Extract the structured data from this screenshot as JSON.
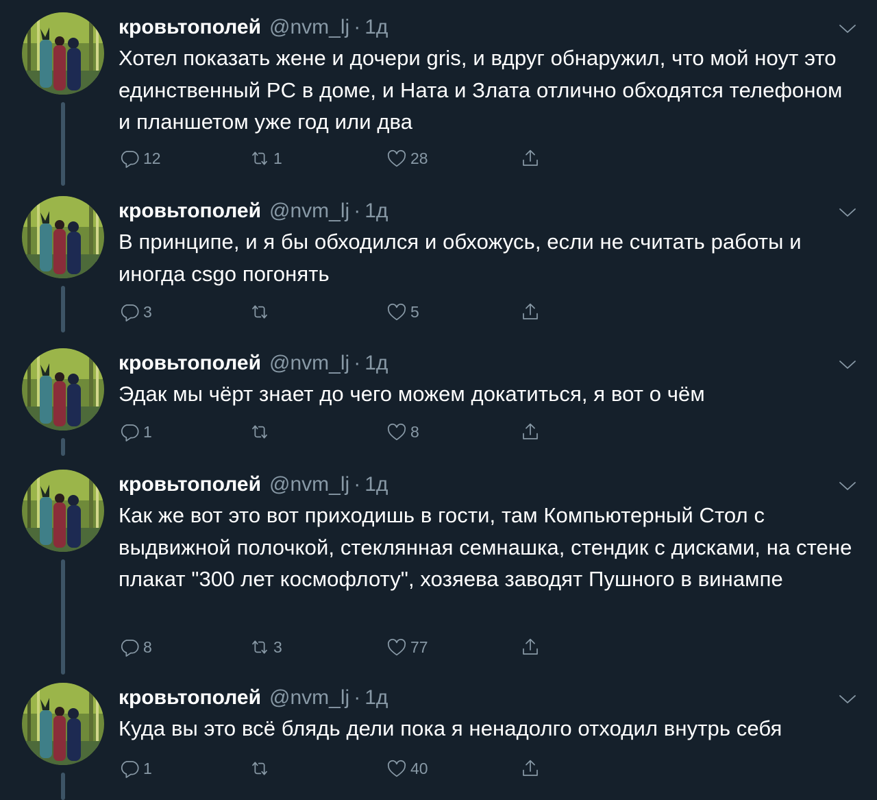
{
  "tweets": [
    {
      "name": "кровьтополей",
      "handle": "@nvm_lj",
      "separator": "·",
      "time": "1д",
      "text": "Хотел показать жене и дочери gris, и вдруг обнаружил, что мой ноут это единственный PC в доме, и Ната и Злата отлично обходятся телефоном и планшетом уже год или два",
      "replies": "12",
      "retweets": "1",
      "likes": "28"
    },
    {
      "name": "кровьтополей",
      "handle": "@nvm_lj",
      "separator": "·",
      "time": "1д",
      "text": "В принципе, и я бы обходился и обхожусь, если не считать работы и иногда csgo погонять",
      "replies": "3",
      "retweets": "",
      "likes": "5"
    },
    {
      "name": "кровьтополей",
      "handle": "@nvm_lj",
      "separator": "·",
      "time": "1д",
      "text": "Эдак мы чёрт знает до чего можем докатиться, я вот о чём",
      "replies": "1",
      "retweets": "",
      "likes": "8"
    },
    {
      "name": "кровьтополей",
      "handle": "@nvm_lj",
      "separator": "·",
      "time": "1д",
      "text": "Как же вот это вот приходишь в гости, там Компьютерный Стол с выдвижной полочкой, стеклянная семнашка, стендик с дисками, на стене плакат \"300 лет космофлоту\", хозяева заводят Пушного в винампе",
      "replies": "8",
      "retweets": "3",
      "likes": "77"
    },
    {
      "name": "кровьтополей",
      "handle": "@nvm_lj",
      "separator": "·",
      "time": "1д",
      "text": "Куда вы это всё блядь дели пока я ненадолго отходил внутрь себя",
      "replies": "1",
      "retweets": "",
      "likes": "40"
    }
  ],
  "icons": {
    "reply": "reply-icon",
    "retweet": "retweet-icon",
    "like": "like-icon",
    "share": "share-icon",
    "menu": "chevron-down-icon"
  },
  "colors": {
    "background": "#15202b",
    "text": "#ffffff",
    "secondary": "#8899a6",
    "thread_line": "#3d5466"
  }
}
